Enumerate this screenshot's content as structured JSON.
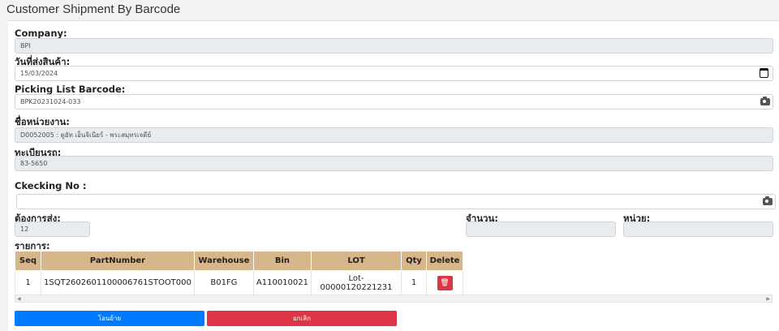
{
  "page": {
    "title": "Customer Shipment By Barcode"
  },
  "form": {
    "company_label": "Company:",
    "company_value": "BPI",
    "ship_date_label": "วันที่ส่งสินค้า:",
    "ship_date_value": "15/03/2024",
    "picking_label": "Picking List Barcode:",
    "picking_value": "BPK20231024-033",
    "dept_label": "ชื่อหน่วยงาน:",
    "dept_value": "D0052005 : ดูอัท เอ็นจิเนียร์ - พระสมุทรเจดีย์",
    "plate_label": "ทะเบียนรถ:",
    "plate_value": "83-5650",
    "checking_label": "Ckecking No :",
    "checking_value": "",
    "required_label": "ต้องการส่ง:",
    "required_value": "12",
    "quantity_label": "จำนวน:",
    "quantity_value": "",
    "unit_label": "หน่วย:",
    "unit_value": "",
    "items_label": "รายการ:"
  },
  "table": {
    "headers": [
      "Seq",
      "PartNumber",
      "Warehouse",
      "Bin",
      "LOT",
      "Qty",
      "Delete"
    ],
    "rows": [
      {
        "seq": "1",
        "part": "1SQT2602601100006761STOOT000",
        "warehouse": "B01FG",
        "bin": "A110010021",
        "lot": "Lot-00000120221231",
        "qty": "1"
      }
    ]
  },
  "actions": {
    "transfer_label": "โอนย้าย",
    "cancel_label": "ยกเลิก"
  },
  "colors": {
    "header_bg": "#d7b68b",
    "primary": "#007bff",
    "danger": "#dc3545"
  }
}
